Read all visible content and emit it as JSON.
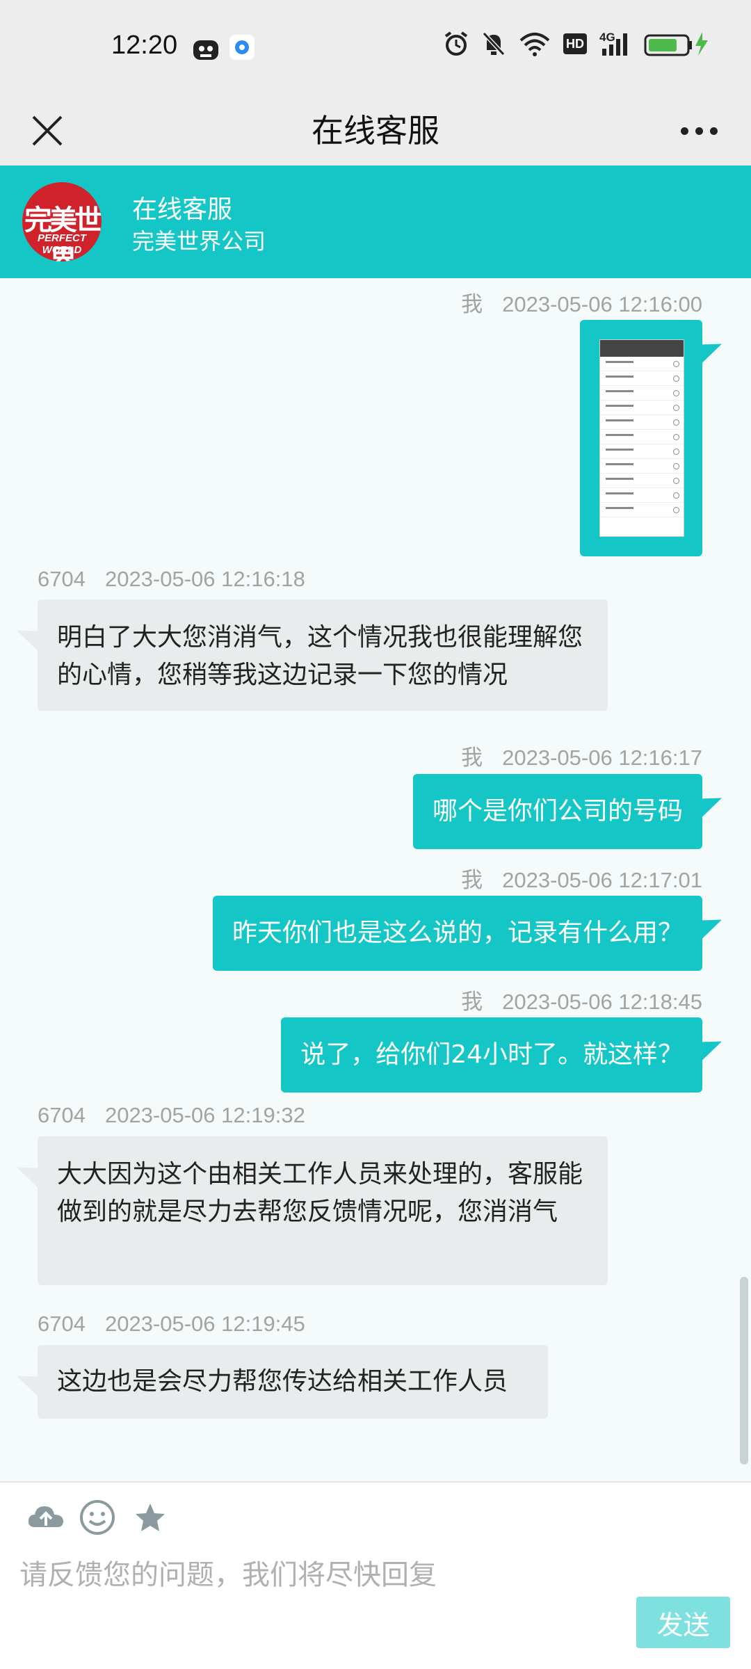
{
  "status_bar": {
    "time": "12:20",
    "network": "4G",
    "hd": "HD"
  },
  "title_bar": {
    "title": "在线客服"
  },
  "agent": {
    "name": "在线客服",
    "company": "完美世界公司",
    "logo_main": "完美世界",
    "logo_sub": "PERFECT WORLD"
  },
  "messages": [
    {
      "sender": "我",
      "time": "2023-05-06 12:16:00",
      "type": "image"
    },
    {
      "sender": "6704",
      "time": "2023-05-06 12:16:18",
      "text": "明白了大大您消消气，这个情况我也很能理解您的心情，您稍等我这边记录一下您的情况"
    },
    {
      "sender": "我",
      "time": "2023-05-06 12:16:17",
      "text": "哪个是你们公司的号码"
    },
    {
      "sender": "我",
      "time": "2023-05-06 12:17:01",
      "text": "昨天你们也是这么说的，记录有什么用？"
    },
    {
      "sender": "我",
      "time": "2023-05-06 12:18:45",
      "text": "说了，给你们24小时了。就这样？"
    },
    {
      "sender": "6704",
      "time": "2023-05-06 12:19:32",
      "text": "大大因为这个由相关工作人员来处理的，客服能做到的就是尽力去帮您反馈情况呢，您消消气"
    },
    {
      "sender": "6704",
      "time": "2023-05-06 12:19:45",
      "text": "这边也是会尽力帮您传达给相关工作人员"
    }
  ],
  "input": {
    "placeholder": "请反馈您的问题，我们将尽快回复",
    "value": "",
    "send_label": "发送"
  },
  "colors": {
    "accent": "#14c6c6",
    "send_button": "#7fe0e0",
    "incoming_bubble": "#e9ecec"
  },
  "icons": [
    "close-icon",
    "more-icon",
    "upload-icon",
    "emoji-icon",
    "star-icon"
  ]
}
